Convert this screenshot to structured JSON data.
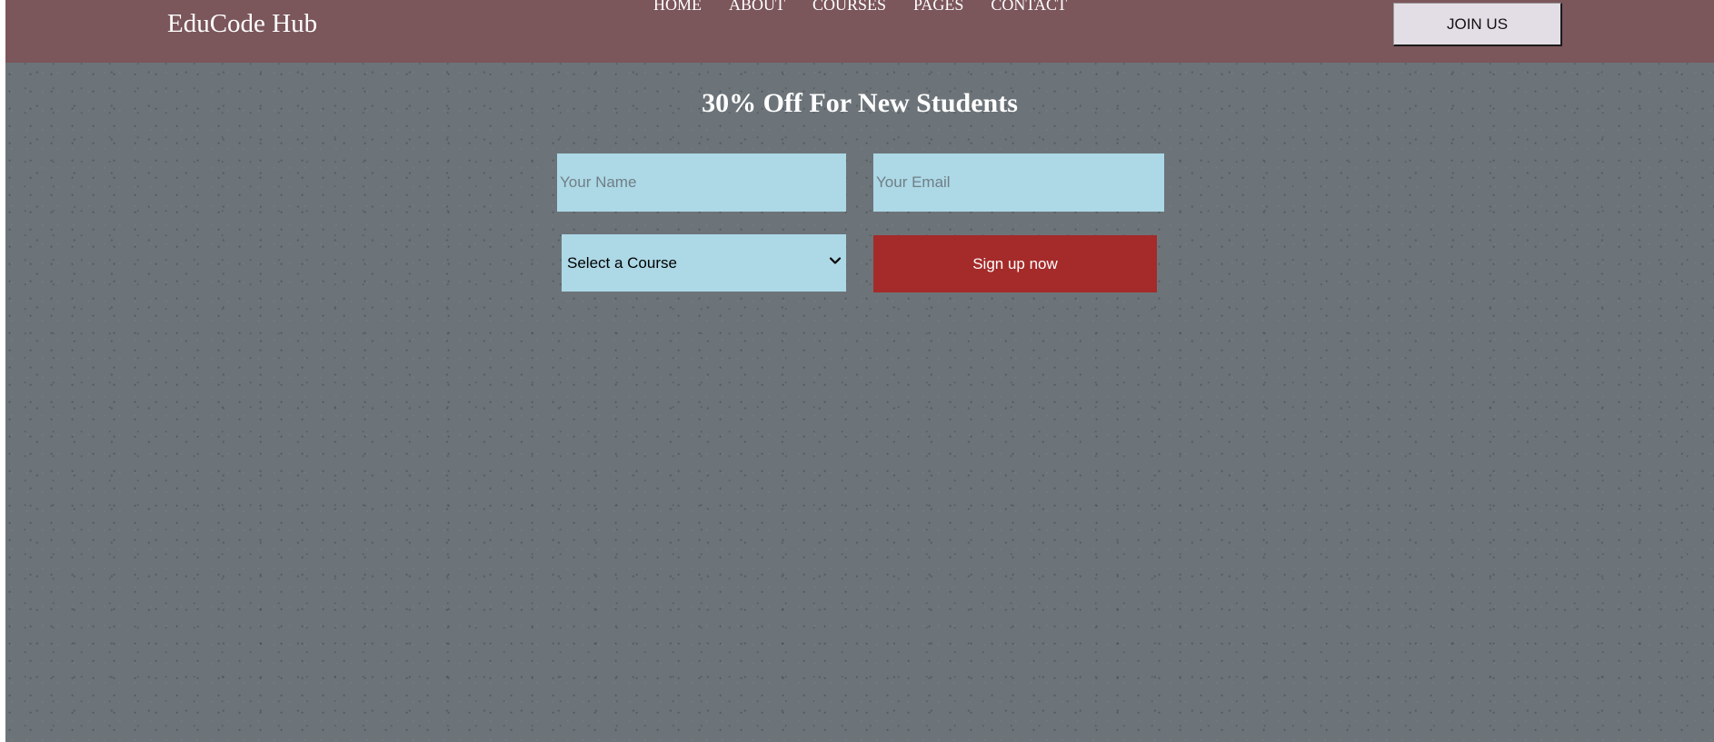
{
  "header": {
    "brand": "EduCode Hub",
    "nav": [
      "HOME",
      "ABOUT",
      "COURSES",
      "PAGES",
      "CONTACT"
    ],
    "join_label": "JOIN US"
  },
  "offer": {
    "title": "30% Off For New Students",
    "name_placeholder": "Your Name",
    "email_placeholder": "Your Email",
    "course_selected": "Select a Course",
    "signup_label": "Sign up now"
  },
  "colors": {
    "header_bg": "#7b565b",
    "page_bg": "#6c7479",
    "input_bg": "#add8e6",
    "signup_bg": "#a52a2a",
    "join_bg": "#e3dde6"
  },
  "icons": {
    "course_dropdown": "chevron-down-icon"
  }
}
